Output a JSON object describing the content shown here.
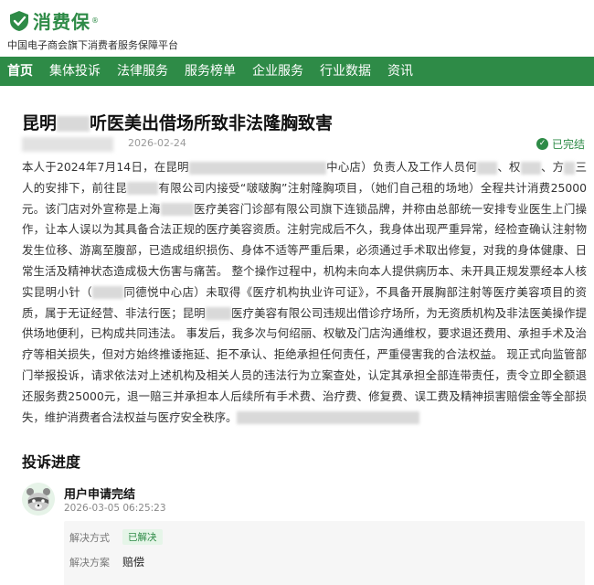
{
  "brand": {
    "name": "消费保",
    "reg": "®",
    "slogan": "中国电子商会旗下消费者服务保障平台",
    "brand_color": "#2e8b47"
  },
  "nav": {
    "items": [
      {
        "label": "首页"
      },
      {
        "label": "集体投诉"
      },
      {
        "label": "法律服务"
      },
      {
        "label": "服务榜单"
      },
      {
        "label": "企业服务"
      },
      {
        "label": "行业数据"
      },
      {
        "label": "资讯"
      }
    ]
  },
  "article": {
    "title_a": "昆明",
    "title_b": "听医美出借场所致非法隆胸致害",
    "date": "2026-02-24",
    "status": "已完结",
    "p": {
      "s1": "本人于2024年7月14日，在昆明",
      "s2": "中心店）负责人及工作人员何",
      "s3": "、权",
      "s4": "、方",
      "s5": "三人的安排下，前往昆",
      "s6": "有限公司内接受“啵啵胸”注射隆胸项目，（她们自己租的场地）全程共计消费25000元。该门店对外宣称是上海",
      "s7": "医疗美容门诊部有限公司旗下连锁品牌，并称由总部统一安排专业医生上门操作，让本人误以为其具备合法正规的医疗美容资质。注射完成后不久，我身体出现严重异常，经检查确认注射物发生位移、游离至腹部，已造成组织损伤、身体不适等严重后果，必须通过手术取出修复，对我的身体健康、日常生活及精神状态造成极大伤害与痛苦。 整个操作过程中，机构未向本人提供病历本、未开具正规发票经本人核实昆明小针（",
      "s8": "同德悦中心店）未取得《医疗机构执业许可证》，不具备开展胸部注射等医疗美容项目的资质，属于无证经营、非法行医；昆明",
      "s9": "医疗美容有限公司违规出借诊疗场所，为无资质机构及非法医美操作提供场地便利，已构成共同违法。 事发后，我多次与何绍丽、权敏及门店沟通维权，要求退还费用、承担手术及治疗等相关损失，但对方始终推诿拖延、拒不承认、拒绝承担任何责任，严重侵害我的合法权益。 现正式向监管部门举报投诉，请求依法对上述机构及相关人员的违法行为立案查处，认定其承担全部连带责任，责令立即全额退还服务费25000元，退一赔三并承担本人后续所有手术费、治疗费、修复费、误工费及精神损害赔偿金等全部损失，维护消费者合法权益与医疗安全秩序。"
    }
  },
  "progress": {
    "title": "投诉进度",
    "step": {
      "title": "用户申请完结",
      "time": "2026-03-05 06:25:23",
      "method_label": "解决方式",
      "method_value": "已解决",
      "plan_label": "解决方案",
      "plan_value": "赔偿"
    }
  }
}
